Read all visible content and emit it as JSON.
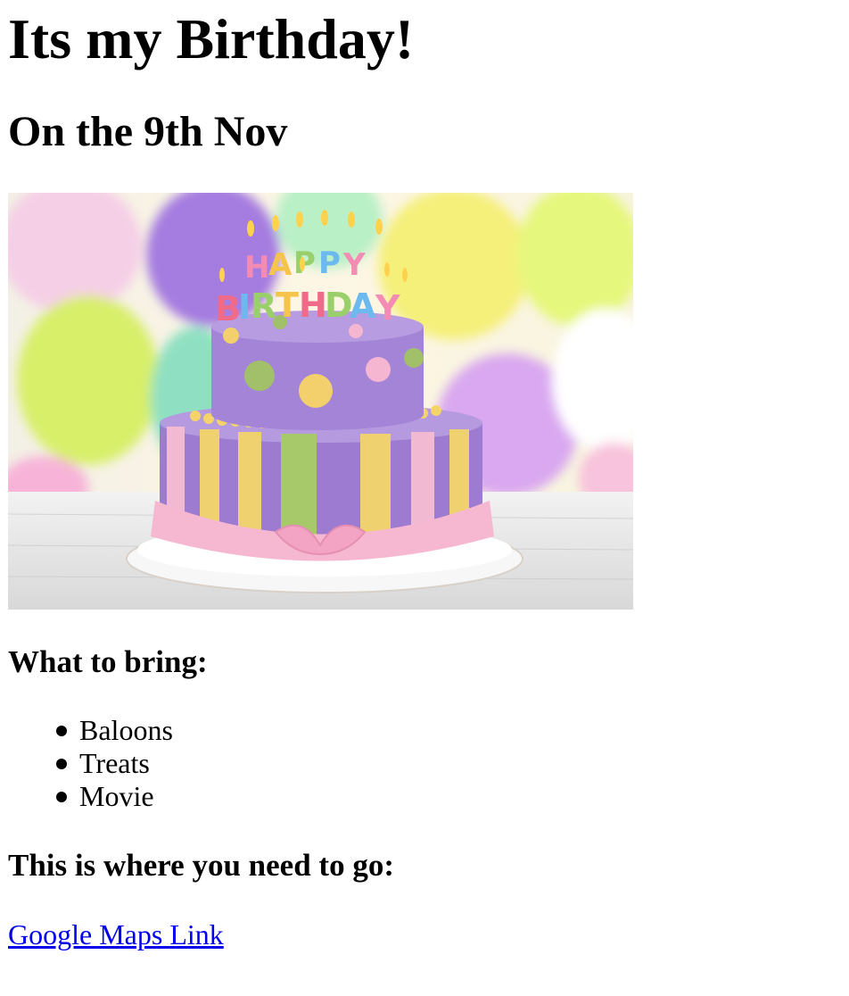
{
  "page": {
    "title": "Its my Birthday!",
    "subtitle": "On the 9th Nov"
  },
  "hero_image": {
    "alt": "Happy Birthday cake",
    "candle_letters": "HAPPY BIRTHDAY"
  },
  "bring_section": {
    "heading": "What to bring:",
    "items": [
      "Baloons",
      "Treats",
      "Movie"
    ]
  },
  "directions_section": {
    "heading": "This is where you need to go:",
    "link_text": "Google Maps Link"
  },
  "colors": {
    "link": "#0000ee",
    "text": "#000000",
    "background": "#ffffff"
  }
}
